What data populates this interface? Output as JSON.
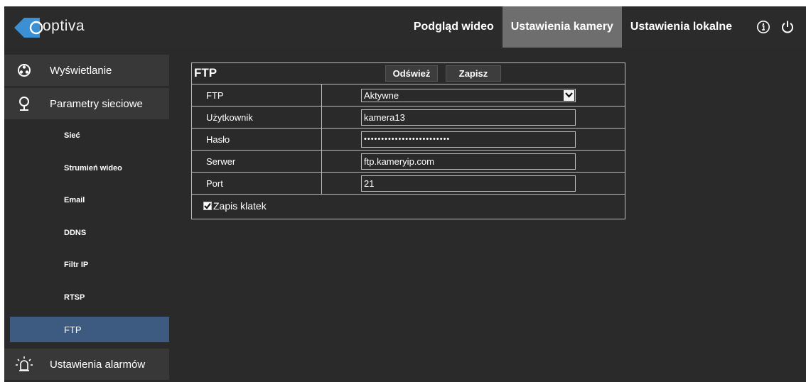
{
  "app": {
    "logo_text": "optiva"
  },
  "topnav": {
    "items": [
      {
        "label": "Podgląd wideo",
        "active": false
      },
      {
        "label": "Ustawienia kamery",
        "active": true
      },
      {
        "label": "Ustawienia lokalne",
        "active": false
      }
    ],
    "icons": [
      "info-icon",
      "power-icon"
    ]
  },
  "sidebar": {
    "groups": [
      {
        "label": "Wyświetlanie",
        "icon": "display-settings-icon"
      },
      {
        "label": "Parametry sieciowe",
        "icon": "network-pin-icon"
      },
      {
        "label": "Ustawienia alarmów",
        "icon": "alarm-light-icon"
      }
    ],
    "subitems": [
      {
        "label": "Sieć",
        "active": false
      },
      {
        "label": "Strumień wideo",
        "active": false
      },
      {
        "label": "Email",
        "active": false
      },
      {
        "label": "DDNS",
        "active": false
      },
      {
        "label": "Filtr IP",
        "active": false
      },
      {
        "label": "RTSP",
        "active": false
      },
      {
        "label": "FTP",
        "active": true
      }
    ]
  },
  "panel": {
    "title": "FTP",
    "refresh_label": "Odśwież",
    "save_label": "Zapisz",
    "rows": [
      {
        "label": "FTP",
        "value": "Aktywne",
        "type": "select"
      },
      {
        "label": "Użytkownik",
        "value": "kamera13",
        "type": "text"
      },
      {
        "label": "Hasło",
        "value": "•••••••••••••••••••••••••",
        "type": "password"
      },
      {
        "label": "Serwer",
        "value": "ftp.kameryip.com",
        "type": "text"
      },
      {
        "label": "Port",
        "value": "21",
        "type": "text"
      }
    ],
    "checkbox": {
      "label": "Zapis klatek",
      "checked": true
    }
  },
  "colors": {
    "background": "#2a2a2a",
    "sidebar_group": "#383838",
    "active_tab": "#6e6e6e",
    "active_subitem": "#3d5a80",
    "logo_blue": "#3b8fd4",
    "border": "#bdbdbd"
  }
}
